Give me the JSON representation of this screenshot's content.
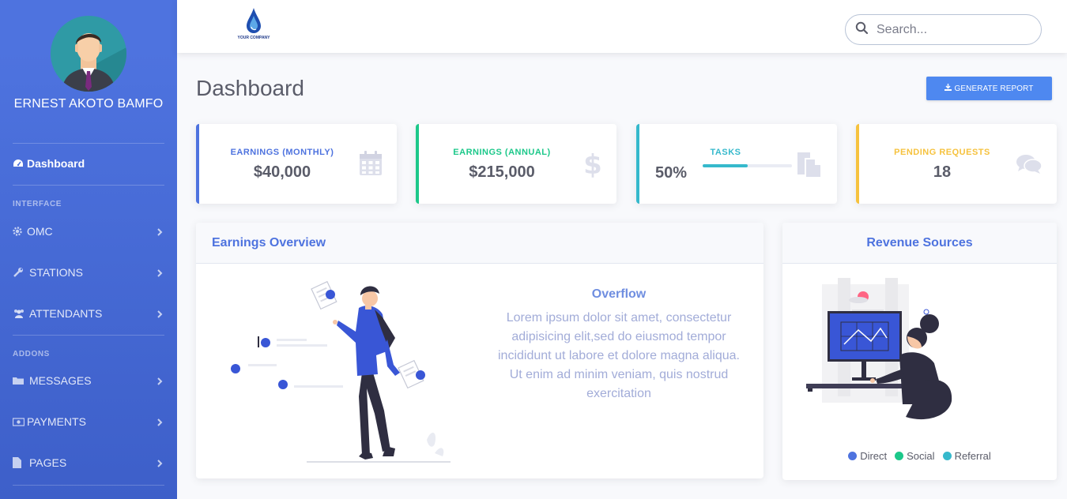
{
  "user": {
    "name": "ERNEST AKOTO BAMFO"
  },
  "brand": {
    "logo_text": "YOUR COMPANY"
  },
  "sidebar": {
    "dashboard": {
      "label": "Dashboard",
      "icon": "tachometer-icon"
    },
    "sections": [
      {
        "heading": "INTERFACE",
        "items": [
          {
            "label": "OMC",
            "icon": "gear-icon"
          },
          {
            "label": "STATIONS",
            "icon": "wrench-icon"
          },
          {
            "label": "ATTENDANTS",
            "icon": "users-icon"
          }
        ]
      },
      {
        "heading": "ADDONS",
        "items": [
          {
            "label": "MESSAGES",
            "icon": "folder-icon"
          },
          {
            "label": "PAYMENTS",
            "icon": "money-icon"
          },
          {
            "label": "PAGES",
            "icon": "file-icon"
          }
        ]
      }
    ]
  },
  "search": {
    "placeholder": "Search..."
  },
  "page": {
    "title": "Dashboard",
    "generate_report": "GENERATE REPORT"
  },
  "stats": [
    {
      "label": "EARNINGS (MONTHLY)",
      "value": "$40,000",
      "color": "#4e73df",
      "icon": "calendar-icon"
    },
    {
      "label": "EARNINGS (ANNUAL)",
      "value": "$215,000",
      "color": "#1cc88a",
      "icon": "dollar-icon"
    },
    {
      "label": "TASKS",
      "value": "50%",
      "progress": 0.5,
      "color": "#36b9cc",
      "icon": "clipboard-icon"
    },
    {
      "label": "PENDING REQUESTS",
      "value": "18",
      "color": "#f6c23e",
      "icon": "comments-icon"
    }
  ],
  "earnings_overview": {
    "title": "Earnings Overview",
    "subtitle": "Overflow",
    "body": "Lorem ipsum dolor sit amet, consectetur adipisicing elit,sed do eiusmod tempor incididunt ut labore et dolore magna aliqua. Ut enim ad minim veniam, quis nostrud exercitation"
  },
  "revenue_sources": {
    "title": "Revenue Sources",
    "legend": [
      {
        "label": "Direct",
        "color": "#4e73df"
      },
      {
        "label": "Social",
        "color": "#1cc88a"
      },
      {
        "label": "Referral",
        "color": "#36b9cc"
      }
    ]
  }
}
